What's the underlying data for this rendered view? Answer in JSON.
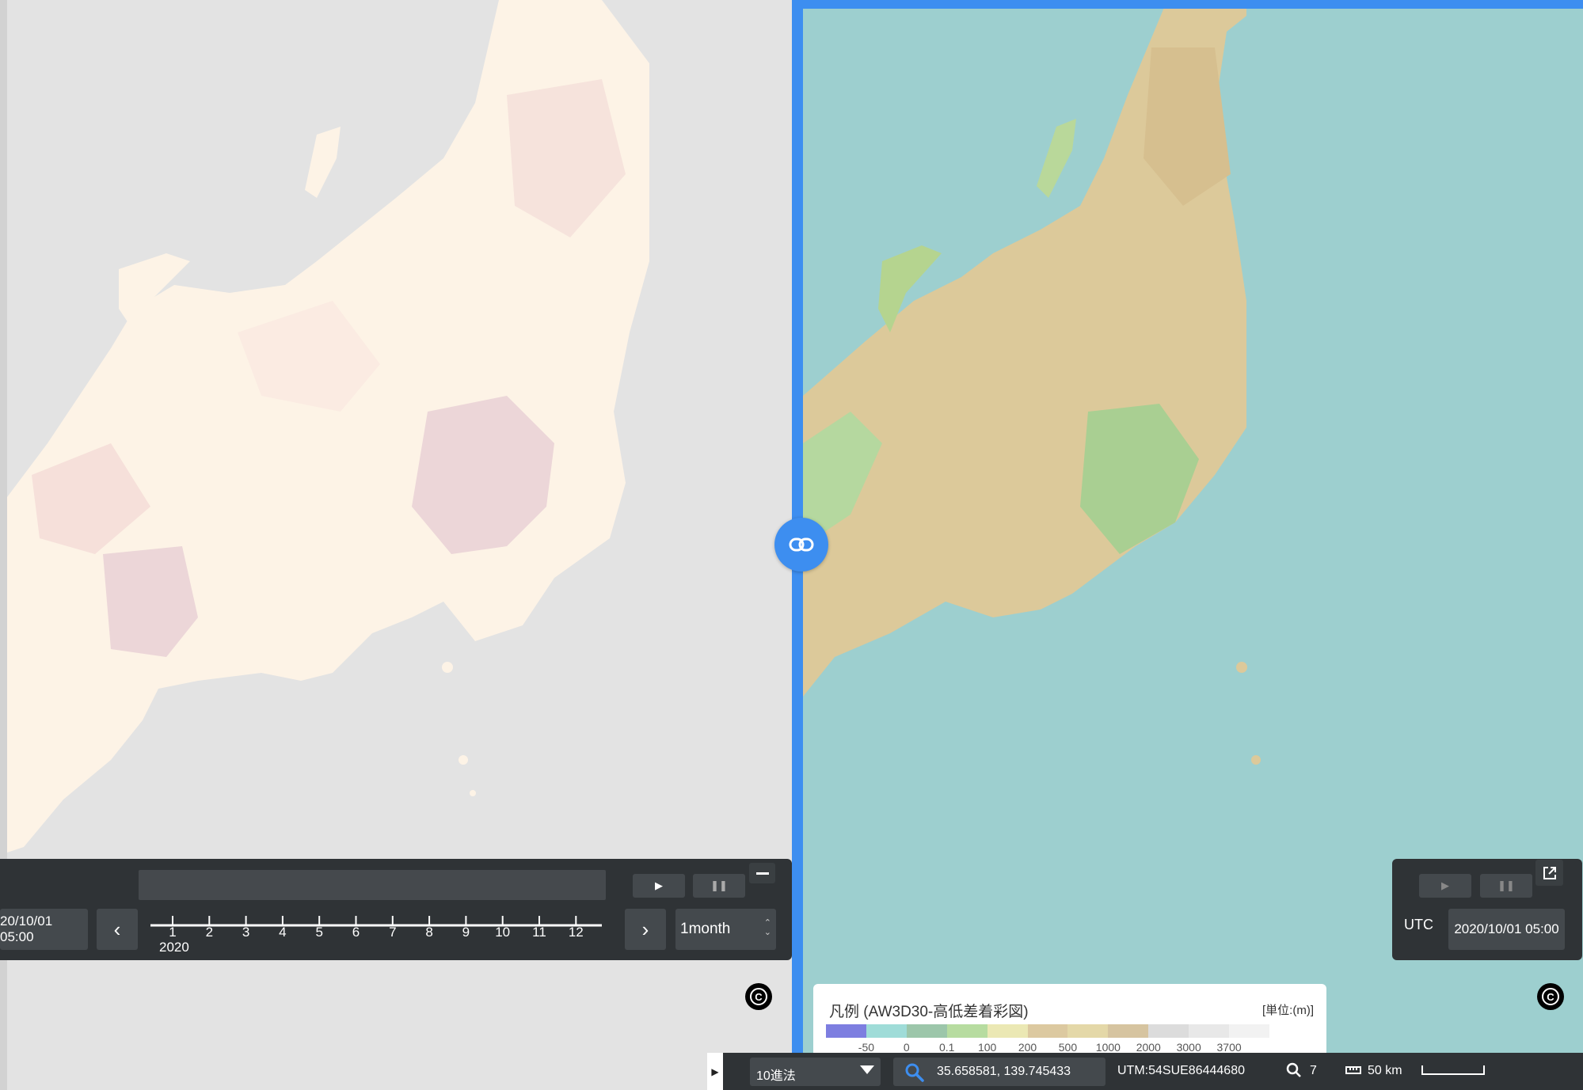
{
  "left_time": {
    "datetime": "20/10/01 05:00",
    "interval": "1month",
    "year": "2020",
    "months": [
      "1",
      "2",
      "3",
      "4",
      "5",
      "6",
      "7",
      "8",
      "9",
      "10",
      "11",
      "12"
    ]
  },
  "right_time": {
    "timezone": "UTC",
    "datetime": "2020/10/01 05:00"
  },
  "legend": {
    "title": "凡例 (AW3D30-高低差着彩図)",
    "unit": "[単位:(m)]",
    "colors": [
      "#7d7ee0",
      "#9fdcd8",
      "#9cc6aa",
      "#b7dca0",
      "#ebe8b4",
      "#dcc9a0",
      "#e4d8a8",
      "#d6c4a0",
      "#dcdcdc",
      "#e8e8e8",
      "#f2f2f2"
    ],
    "ticks": [
      "-50",
      "0",
      "0.1",
      "100",
      "200",
      "500",
      "1000",
      "2000",
      "3000",
      "3700"
    ]
  },
  "status": {
    "coord_format": "10進法",
    "coordinates": "35.658581, 139.745433",
    "utm": "UTM:54SUE86444680",
    "zoom": "7",
    "scale": "50 km"
  },
  "colors": {
    "accent": "#3d8ef0",
    "panel": "#2f3336",
    "sea_left": "#e3e3e3",
    "sea_right": "#9dcfcf"
  }
}
